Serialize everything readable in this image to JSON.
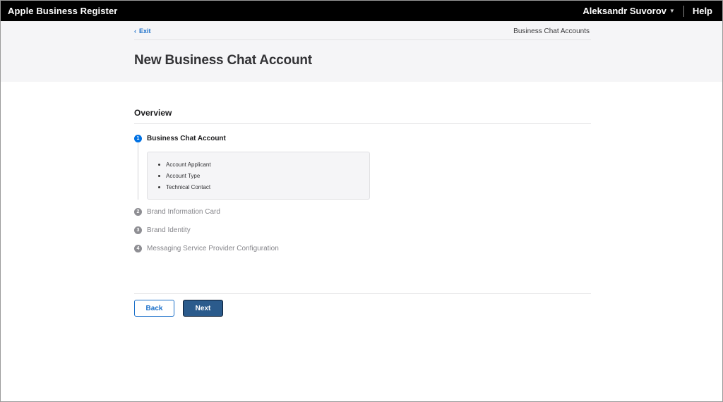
{
  "topbar": {
    "brand": "Apple Business Register",
    "user": "Aleksandr Suvorov",
    "help": "Help"
  },
  "header": {
    "exit_label": "Exit",
    "breadcrumb": "Business Chat Accounts",
    "title": "New Business Chat Account"
  },
  "overview": {
    "title": "Overview",
    "steps": [
      {
        "num": "1",
        "label": "Business Chat Account",
        "active": true
      },
      {
        "num": "2",
        "label": "Brand Information Card",
        "active": false
      },
      {
        "num": "3",
        "label": "Brand Identity",
        "active": false
      },
      {
        "num": "4",
        "label": "Messaging Service Provider Configuration",
        "active": false
      }
    ],
    "substeps": [
      "Account Applicant",
      "Account Type",
      "Technical Contact"
    ]
  },
  "actions": {
    "back_label": "Back",
    "next_label": "Next"
  },
  "colors": {
    "accent": "#0071e3",
    "link": "#1a6fc9",
    "primary_button": "#2b5b8c"
  }
}
